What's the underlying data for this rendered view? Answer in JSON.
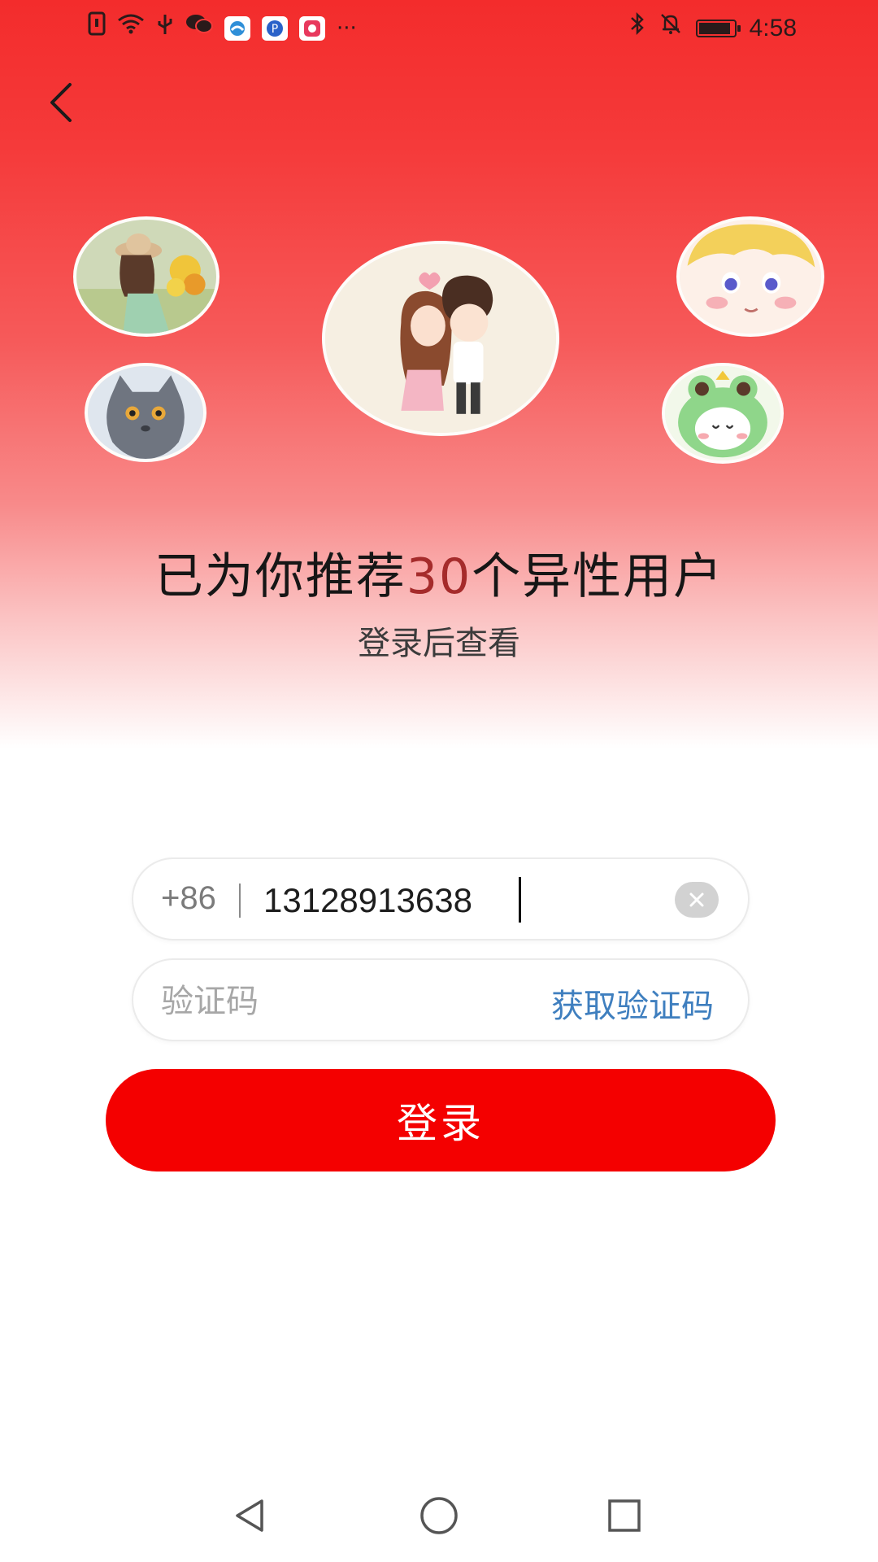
{
  "status_bar": {
    "time": "4:58",
    "more_glyph": "···",
    "left_icons": [
      "sim-icon",
      "wifi-icon",
      "usb-icon",
      "wechat-icon",
      "app-icon-1",
      "app-icon-2",
      "app-icon-3"
    ],
    "right_icons": [
      "bluetooth-icon",
      "mute-icon",
      "battery-icon"
    ],
    "battery_level": 0.9
  },
  "header": {
    "back_icon": "chevron-left-icon"
  },
  "recommendation": {
    "prefix": "已为你推荐",
    "count": "30",
    "suffix": "个异性用户",
    "subtitle": "登录后查看",
    "count_color": "#a52b2b"
  },
  "login_form": {
    "country_code": "+86",
    "phone_value": "13128913638",
    "code_placeholder": "验证码",
    "get_code_label": "获取验证码",
    "submit_label": "登录",
    "accent": "#f40000",
    "link_color": "#3f7fbf"
  },
  "nav_bar": {
    "buttons": [
      "back-triangle-icon",
      "home-circle-icon",
      "recents-square-icon"
    ]
  }
}
